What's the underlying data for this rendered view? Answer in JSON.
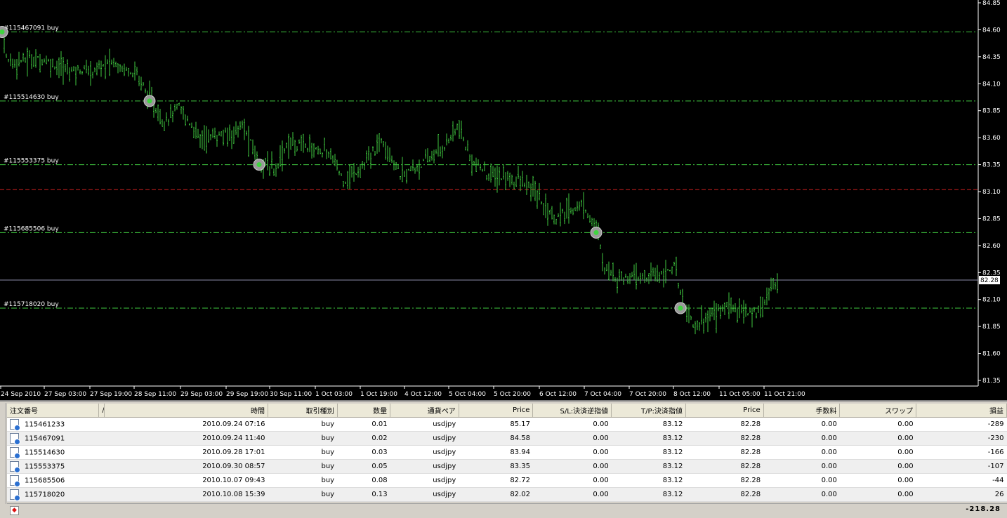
{
  "chart": {
    "price_levels": [
      "84.85",
      "84.60",
      "84.35",
      "84.10",
      "83.85",
      "83.60",
      "83.35",
      "83.10",
      "82.85",
      "82.60",
      "82.35",
      "82.10",
      "81.85",
      "81.60",
      "81.35"
    ],
    "current_price": "82.28",
    "time_labels": [
      "24 Sep 2010",
      "27 Sep 03:00",
      "27 Sep 19:00",
      "28 Sep 11:00",
      "29 Sep 03:00",
      "29 Sep 19:00",
      "30 Sep 11:00",
      "1 Oct 03:00",
      "1 Oct 19:00",
      "4 Oct 12:00",
      "5 Oct 04:00",
      "5 Oct 20:00",
      "6 Oct 12:00",
      "7 Oct 04:00",
      "7 Oct 20:00",
      "8 Oct 12:00",
      "11 Oct 05:00",
      "11 Oct 21:00"
    ],
    "order_lines": [
      {
        "label": "#115467091 buy",
        "price": 84.58
      },
      {
        "label": "#115514630 buy",
        "price": 83.94
      },
      {
        "label": "#115553375 buy",
        "price": 83.35
      },
      {
        "label": "#115685506 buy",
        "price": 82.72
      },
      {
        "label": "#115718020 buy",
        "price": 82.02
      }
    ],
    "tp_price": 83.12,
    "colors": {
      "candles": "#3fc83f",
      "order_line": "#3fc83f",
      "tp_line": "#d02020",
      "price_line": "#8a8aa8"
    }
  },
  "table": {
    "headers": [
      "注文番号",
      "/",
      "時間",
      "取引種別",
      "数量",
      "通貨ペア",
      "Price",
      "S/L:決済逆指値",
      "T/P:決済指値",
      "Price",
      "手数料",
      "スワップ",
      "損益"
    ],
    "rows": [
      [
        "115461233",
        "2010.09.24 07:16",
        "buy",
        "0.01",
        "usdjpy",
        "85.17",
        "0.00",
        "83.12",
        "82.28",
        "0.00",
        "0.00",
        "-289"
      ],
      [
        "115467091",
        "2010.09.24 11:40",
        "buy",
        "0.02",
        "usdjpy",
        "84.58",
        "0.00",
        "83.12",
        "82.28",
        "0.00",
        "0.00",
        "-230"
      ],
      [
        "115514630",
        "2010.09.28 17:01",
        "buy",
        "0.03",
        "usdjpy",
        "83.94",
        "0.00",
        "83.12",
        "82.28",
        "0.00",
        "0.00",
        "-166"
      ],
      [
        "115553375",
        "2010.09.30 08:57",
        "buy",
        "0.05",
        "usdjpy",
        "83.35",
        "0.00",
        "83.12",
        "82.28",
        "0.00",
        "0.00",
        "-107"
      ],
      [
        "115685506",
        "2010.10.07 09:43",
        "buy",
        "0.08",
        "usdjpy",
        "82.72",
        "0.00",
        "83.12",
        "82.28",
        "0.00",
        "0.00",
        "-44"
      ],
      [
        "115718020",
        "2010.10.08 15:39",
        "buy",
        "0.13",
        "usdjpy",
        "82.02",
        "0.00",
        "83.12",
        "82.28",
        "0.00",
        "0.00",
        "26"
      ]
    ],
    "total": "-218.28"
  }
}
